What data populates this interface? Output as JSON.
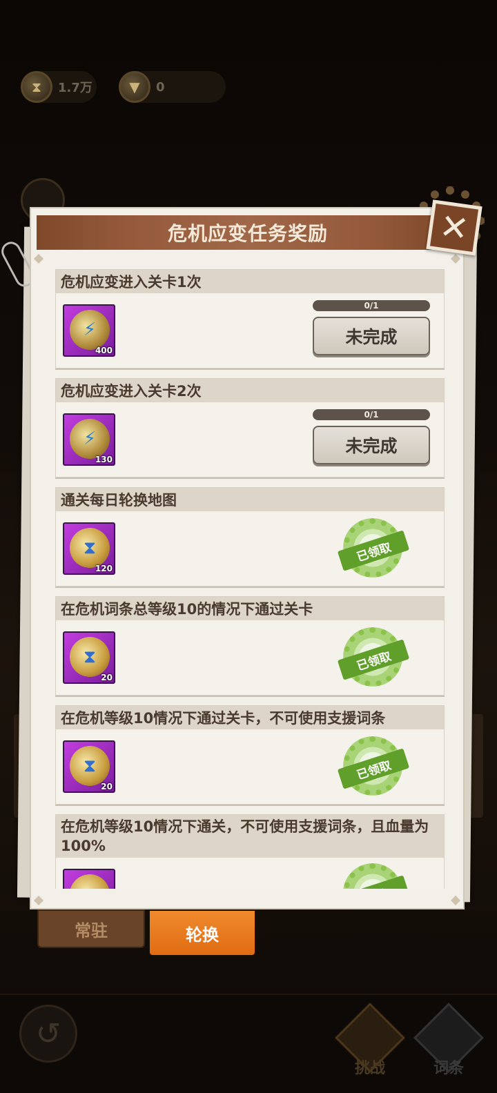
{
  "currencies": [
    {
      "icon": "hourglass-coin-icon",
      "value": "1.7万"
    },
    {
      "icon": "emblem-coin-icon",
      "value": "0"
    }
  ],
  "modal": {
    "title": "危机应变任务奖励",
    "close_symbol": "✕"
  },
  "tasks": [
    {
      "title": "危机应变进入关卡1次",
      "item": "chip-icon",
      "count": "400",
      "progress": "0/1",
      "status": "未完成",
      "claimed": false
    },
    {
      "title": "危机应变进入关卡2次",
      "item": "chip-icon",
      "count": "130",
      "progress": "0/1",
      "status": "未完成",
      "claimed": false
    },
    {
      "title": "通关每日轮换地图",
      "item": "hourglass-icon",
      "count": "120",
      "status": "已领取",
      "claimed": true
    },
    {
      "title": "在危机词条总等级10的情况下通过关卡",
      "item": "hourglass-icon",
      "count": "20",
      "status": "已领取",
      "claimed": true
    },
    {
      "title": "在危机等级10情况下通过关卡，不可使用支援词条",
      "item": "hourglass-icon",
      "count": "20",
      "status": "已领取",
      "claimed": true
    },
    {
      "title": "在危机等级10情况下通关，不可使用支援词条，且血量为100%",
      "item": "hourglass-icon",
      "status": "已领",
      "claimed": true
    }
  ],
  "tabs": {
    "normal": "常驻",
    "rotate": "轮换"
  },
  "bottom": {
    "back_symbol": "↺",
    "challenge": "挑战",
    "entries": "词条"
  },
  "colors": {
    "header": "#93593a",
    "tab_active": "#f08a2c",
    "claimed": "#5f9f2a"
  }
}
